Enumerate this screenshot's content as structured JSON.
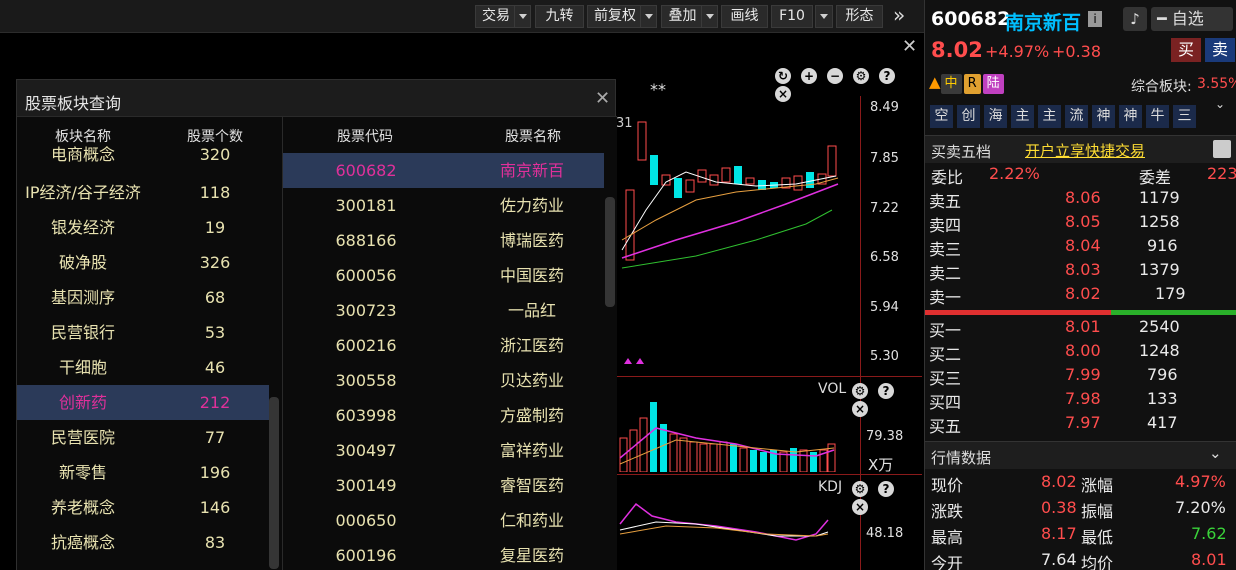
{
  "toolbar": {
    "trade": "交易",
    "jiuzhuan": "九转",
    "adjust": "前复权",
    "overlay": "叠加",
    "draw": "画线",
    "f10": "F10",
    "pattern": "形态",
    "more": "»",
    "close": "✕"
  },
  "chart": {
    "marker": "**",
    "price_labels": [
      "8.49",
      "7.85",
      "7.22",
      "6.58",
      "5.94",
      "5.30"
    ],
    "vol_label": "VOL",
    "vol_value": "79.38",
    "vol_unit": "X万",
    "kdj_label": "KDJ",
    "kdj_value": "48.18",
    "side_label": "31"
  },
  "modal": {
    "title": "股票板块查询",
    "left_headers": [
      "板块名称",
      "股票个数"
    ],
    "right_headers": [
      "股票代码",
      "股票名称"
    ],
    "sectors": [
      {
        "name": "电商概念",
        "count": "320"
      },
      {
        "name": "IP经济/谷子经济",
        "count": "118"
      },
      {
        "name": "银发经济",
        "count": "19"
      },
      {
        "name": "破净股",
        "count": "326"
      },
      {
        "name": "基因测序",
        "count": "68"
      },
      {
        "name": "民营银行",
        "count": "53"
      },
      {
        "name": "干细胞",
        "count": "46"
      },
      {
        "name": "创新药",
        "count": "212"
      },
      {
        "name": "民营医院",
        "count": "77"
      },
      {
        "name": "新零售",
        "count": "196"
      },
      {
        "name": "养老概念",
        "count": "146"
      },
      {
        "name": "抗癌概念",
        "count": "83"
      }
    ],
    "stocks": [
      {
        "code": "600682",
        "name": "南京新百"
      },
      {
        "code": "300181",
        "name": "佐力药业"
      },
      {
        "code": "688166",
        "name": "博瑞医药"
      },
      {
        "code": "600056",
        "name": "中国医药"
      },
      {
        "code": "300723",
        "name": "一品红"
      },
      {
        "code": "600216",
        "name": "浙江医药"
      },
      {
        "code": "300558",
        "name": "贝达药业"
      },
      {
        "code": "603998",
        "name": "方盛制药"
      },
      {
        "code": "300497",
        "name": "富祥药业"
      },
      {
        "code": "300149",
        "name": "睿智医药"
      },
      {
        "code": "000650",
        "name": "仁和药业"
      },
      {
        "code": "600196",
        "name": "复星医药"
      }
    ]
  },
  "quote": {
    "code": "600682",
    "name": "南京新百",
    "info_icon": "i",
    "watch_label": "自选",
    "price": "8.02",
    "change_pct": "+4.97%",
    "change": "+0.38",
    "buy_btn": "买",
    "sell_btn": "卖",
    "badges": [
      "中",
      "R",
      "陆"
    ],
    "composite_label": "综合板块:",
    "composite_value": "3.55%",
    "tags": [
      "空",
      "创",
      "海",
      "主",
      "主",
      "流",
      "神",
      "神",
      "牛",
      "三"
    ],
    "depth_title": "买卖五档",
    "open_account": "开户立享快捷交易",
    "ratio_label": "委比",
    "ratio_value": "2.22%",
    "diff_label": "委差",
    "diff_value": "223",
    "asks": [
      {
        "label": "卖五",
        "price": "8.06",
        "vol": "1179"
      },
      {
        "label": "卖四",
        "price": "8.05",
        "vol": "1258"
      },
      {
        "label": "卖三",
        "price": "8.04",
        "vol": "916"
      },
      {
        "label": "卖二",
        "price": "8.03",
        "vol": "1379"
      },
      {
        "label": "卖一",
        "price": "8.02",
        "vol": "179"
      }
    ],
    "bids": [
      {
        "label": "买一",
        "price": "8.01",
        "vol": "2540"
      },
      {
        "label": "买二",
        "price": "8.00",
        "vol": "1248"
      },
      {
        "label": "买三",
        "price": "7.99",
        "vol": "796"
      },
      {
        "label": "买四",
        "price": "7.98",
        "vol": "133"
      },
      {
        "label": "买五",
        "price": "7.97",
        "vol": "417"
      }
    ],
    "market_title": "行情数据",
    "market": [
      {
        "l1": "现价",
        "v1": "8.02",
        "l2": "涨幅",
        "v2": "4.97%"
      },
      {
        "l1": "涨跌",
        "v1": "0.38",
        "l2": "振幅",
        "v2": "7.20%"
      },
      {
        "l1": "最高",
        "v1": "8.17",
        "l2": "最低",
        "v2": "7.62"
      },
      {
        "l1": "今开",
        "v1": "7.64",
        "l2": "均价",
        "v2": "8.01"
      }
    ],
    "colors": {
      "up": "#ff4d4d",
      "down": "#3ad33a",
      "accent": "#00bfff"
    }
  }
}
